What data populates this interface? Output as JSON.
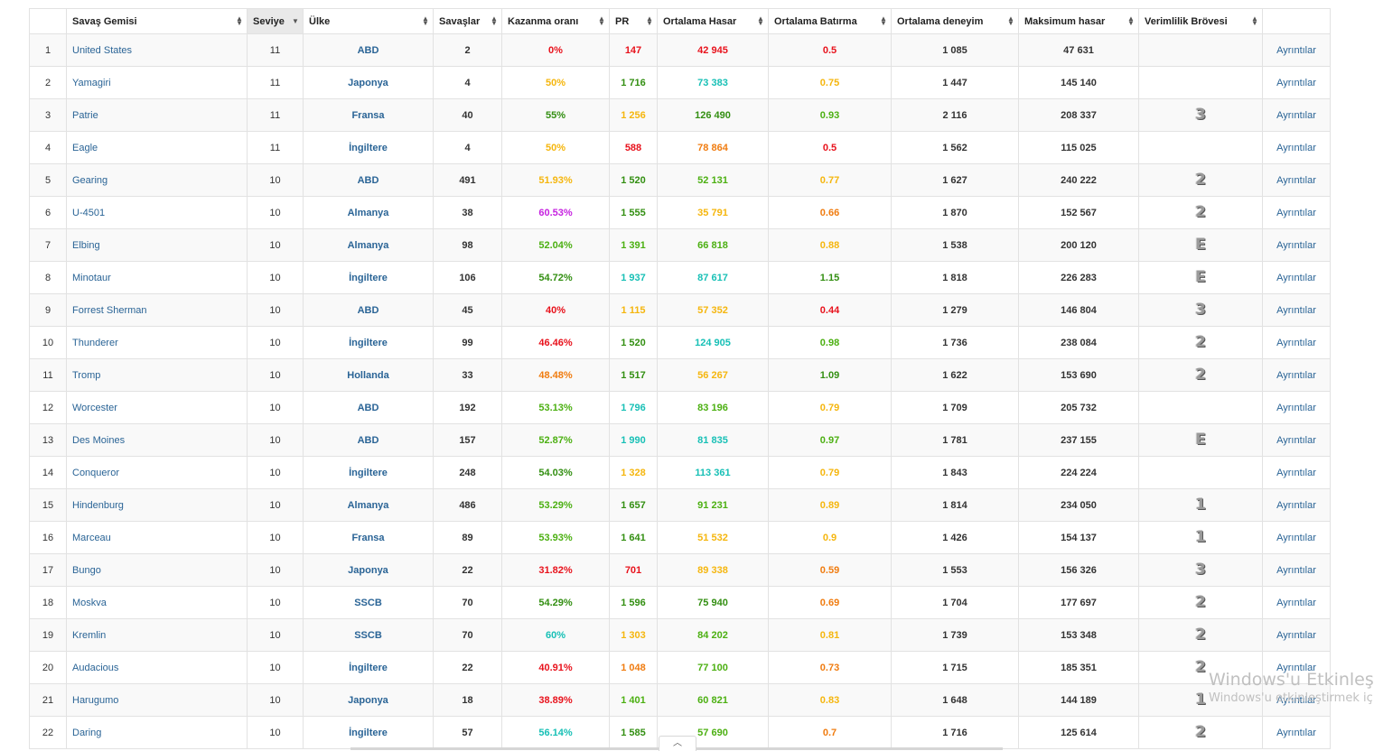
{
  "headers": [
    "",
    "Savaş Gemisi",
    "Seviye",
    "Ülke",
    "Savaşlar",
    "Kazanma oranı",
    "PR",
    "Ortalama Hasar",
    "Ortalama Batırma",
    "Ortalama deneyim",
    "Maksimum hasar",
    "Verimlilik Brövesi",
    ""
  ],
  "rows": [
    {
      "idx": "1",
      "name": "United States",
      "tier": "11",
      "nation": "ABD",
      "battles": "2",
      "wr": "0%",
      "wr_c": "red",
      "pr": "147",
      "pr_c": "red",
      "dmg": "42 945",
      "dmg_c": "red",
      "kills": "0.5",
      "kills_c": "red",
      "xp": "1 085",
      "maxdmg": "47 631",
      "badge": "",
      "details": "Ayrıntılar"
    },
    {
      "idx": "2",
      "name": "Yamagiri",
      "tier": "11",
      "nation": "Japonya",
      "battles": "4",
      "wr": "50%",
      "wr_c": "yellow",
      "pr": "1 716",
      "pr_c": "dgreen",
      "dmg": "73 383",
      "dmg_c": "teal",
      "kills": "0.75",
      "kills_c": "yellow",
      "xp": "1 447",
      "maxdmg": "145 140",
      "badge": "",
      "details": "Ayrıntılar"
    },
    {
      "idx": "3",
      "name": "Patrie",
      "tier": "11",
      "nation": "Fransa",
      "battles": "40",
      "wr": "55%",
      "wr_c": "dgreen",
      "pr": "1 256",
      "pr_c": "yellow",
      "dmg": "126 490",
      "dmg_c": "dgreen",
      "kills": "0.93",
      "kills_c": "lgreen",
      "xp": "2 116",
      "maxdmg": "208 337",
      "badge": "3",
      "details": "Ayrıntılar"
    },
    {
      "idx": "4",
      "name": "Eagle",
      "tier": "11",
      "nation": "İngiltere",
      "battles": "4",
      "wr": "50%",
      "wr_c": "yellow",
      "pr": "588",
      "pr_c": "red",
      "dmg": "78 864",
      "dmg_c": "orange",
      "kills": "0.5",
      "kills_c": "red",
      "xp": "1 562",
      "maxdmg": "115 025",
      "badge": "",
      "details": "Ayrıntılar"
    },
    {
      "idx": "5",
      "name": "Gearing",
      "tier": "10",
      "nation": "ABD",
      "battles": "491",
      "wr": "51.93%",
      "wr_c": "yellow",
      "pr": "1 520",
      "pr_c": "dgreen",
      "dmg": "52 131",
      "dmg_c": "lgreen",
      "kills": "0.77",
      "kills_c": "yellow",
      "xp": "1 627",
      "maxdmg": "240 222",
      "badge": "2",
      "details": "Ayrıntılar"
    },
    {
      "idx": "6",
      "name": "U-4501",
      "tier": "10",
      "nation": "Almanya",
      "battles": "38",
      "wr": "60.53%",
      "wr_c": "purple",
      "pr": "1 555",
      "pr_c": "dgreen",
      "dmg": "35 791",
      "dmg_c": "yellow",
      "kills": "0.66",
      "kills_c": "orange",
      "xp": "1 870",
      "maxdmg": "152 567",
      "badge": "2",
      "details": "Ayrıntılar"
    },
    {
      "idx": "7",
      "name": "Elbing",
      "tier": "10",
      "nation": "Almanya",
      "battles": "98",
      "wr": "52.04%",
      "wr_c": "lgreen",
      "pr": "1 391",
      "pr_c": "lgreen",
      "dmg": "66 818",
      "dmg_c": "lgreen",
      "kills": "0.88",
      "kills_c": "yellow",
      "xp": "1 538",
      "maxdmg": "200 120",
      "badge": "E",
      "details": "Ayrıntılar"
    },
    {
      "idx": "8",
      "name": "Minotaur",
      "tier": "10",
      "nation": "İngiltere",
      "battles": "106",
      "wr": "54.72%",
      "wr_c": "dgreen",
      "pr": "1 937",
      "pr_c": "teal",
      "dmg": "87 617",
      "dmg_c": "teal",
      "kills": "1.15",
      "kills_c": "dgreen",
      "xp": "1 818",
      "maxdmg": "226 283",
      "badge": "E",
      "details": "Ayrıntılar"
    },
    {
      "idx": "9",
      "name": "Forrest Sherman",
      "tier": "10",
      "nation": "ABD",
      "battles": "45",
      "wr": "40%",
      "wr_c": "red",
      "pr": "1 115",
      "pr_c": "yellow",
      "dmg": "57 352",
      "dmg_c": "yellow",
      "kills": "0.44",
      "kills_c": "red",
      "xp": "1 279",
      "maxdmg": "146 804",
      "badge": "3",
      "details": "Ayrıntılar"
    },
    {
      "idx": "10",
      "name": "Thunderer",
      "tier": "10",
      "nation": "İngiltere",
      "battles": "99",
      "wr": "46.46%",
      "wr_c": "red",
      "pr": "1 520",
      "pr_c": "dgreen",
      "dmg": "124 905",
      "dmg_c": "teal",
      "kills": "0.98",
      "kills_c": "lgreen",
      "xp": "1 736",
      "maxdmg": "238 084",
      "badge": "2",
      "details": "Ayrıntılar"
    },
    {
      "idx": "11",
      "name": "Tromp",
      "tier": "10",
      "nation": "Hollanda",
      "battles": "33",
      "wr": "48.48%",
      "wr_c": "orange",
      "pr": "1 517",
      "pr_c": "dgreen",
      "dmg": "56 267",
      "dmg_c": "yellow",
      "kills": "1.09",
      "kills_c": "dgreen",
      "xp": "1 622",
      "maxdmg": "153 690",
      "badge": "2",
      "details": "Ayrıntılar"
    },
    {
      "idx": "12",
      "name": "Worcester",
      "tier": "10",
      "nation": "ABD",
      "battles": "192",
      "wr": "53.13%",
      "wr_c": "lgreen",
      "pr": "1 796",
      "pr_c": "teal",
      "dmg": "83 196",
      "dmg_c": "lgreen",
      "kills": "0.79",
      "kills_c": "yellow",
      "xp": "1 709",
      "maxdmg": "205 732",
      "badge": "",
      "details": "Ayrıntılar"
    },
    {
      "idx": "13",
      "name": "Des Moines",
      "tier": "10",
      "nation": "ABD",
      "battles": "157",
      "wr": "52.87%",
      "wr_c": "lgreen",
      "pr": "1 990",
      "pr_c": "teal",
      "dmg": "81 835",
      "dmg_c": "teal",
      "kills": "0.97",
      "kills_c": "lgreen",
      "xp": "1 781",
      "maxdmg": "237 155",
      "badge": "E",
      "details": "Ayrıntılar"
    },
    {
      "idx": "14",
      "name": "Conqueror",
      "tier": "10",
      "nation": "İngiltere",
      "battles": "248",
      "wr": "54.03%",
      "wr_c": "dgreen",
      "pr": "1 328",
      "pr_c": "yellow",
      "dmg": "113 361",
      "dmg_c": "teal",
      "kills": "0.79",
      "kills_c": "yellow",
      "xp": "1 843",
      "maxdmg": "224 224",
      "badge": "",
      "details": "Ayrıntılar"
    },
    {
      "idx": "15",
      "name": "Hindenburg",
      "tier": "10",
      "nation": "Almanya",
      "battles": "486",
      "wr": "53.29%",
      "wr_c": "lgreen",
      "pr": "1 657",
      "pr_c": "dgreen",
      "dmg": "91 231",
      "dmg_c": "lgreen",
      "kills": "0.89",
      "kills_c": "yellow",
      "xp": "1 814",
      "maxdmg": "234 050",
      "badge": "1",
      "details": "Ayrıntılar"
    },
    {
      "idx": "16",
      "name": "Marceau",
      "tier": "10",
      "nation": "Fransa",
      "battles": "89",
      "wr": "53.93%",
      "wr_c": "lgreen",
      "pr": "1 641",
      "pr_c": "dgreen",
      "dmg": "51 532",
      "dmg_c": "yellow",
      "kills": "0.9",
      "kills_c": "yellow",
      "xp": "1 426",
      "maxdmg": "154 137",
      "badge": "1",
      "details": "Ayrıntılar"
    },
    {
      "idx": "17",
      "name": "Bungo",
      "tier": "10",
      "nation": "Japonya",
      "battles": "22",
      "wr": "31.82%",
      "wr_c": "red",
      "pr": "701",
      "pr_c": "red",
      "dmg": "89 338",
      "dmg_c": "yellow",
      "kills": "0.59",
      "kills_c": "orange",
      "xp": "1 553",
      "maxdmg": "156 326",
      "badge": "3",
      "details": "Ayrıntılar"
    },
    {
      "idx": "18",
      "name": "Moskva",
      "tier": "10",
      "nation": "SSCB",
      "battles": "70",
      "wr": "54.29%",
      "wr_c": "dgreen",
      "pr": "1 596",
      "pr_c": "dgreen",
      "dmg": "75 940",
      "dmg_c": "dgreen",
      "kills": "0.69",
      "kills_c": "orange",
      "xp": "1 704",
      "maxdmg": "177 697",
      "badge": "2",
      "details": "Ayrıntılar"
    },
    {
      "idx": "19",
      "name": "Kremlin",
      "tier": "10",
      "nation": "SSCB",
      "battles": "70",
      "wr": "60%",
      "wr_c": "teal",
      "pr": "1 303",
      "pr_c": "yellow",
      "dmg": "84 202",
      "dmg_c": "lgreen",
      "kills": "0.81",
      "kills_c": "yellow",
      "xp": "1 739",
      "maxdmg": "153 348",
      "badge": "2",
      "details": "Ayrıntılar"
    },
    {
      "idx": "20",
      "name": "Audacious",
      "tier": "10",
      "nation": "İngiltere",
      "battles": "22",
      "wr": "40.91%",
      "wr_c": "red",
      "pr": "1 048",
      "pr_c": "orange",
      "dmg": "77 100",
      "dmg_c": "lgreen",
      "kills": "0.73",
      "kills_c": "orange",
      "xp": "1 715",
      "maxdmg": "185 351",
      "badge": "2",
      "details": "Ayrıntılar"
    },
    {
      "idx": "21",
      "name": "Harugumo",
      "tier": "10",
      "nation": "Japonya",
      "battles": "18",
      "wr": "38.89%",
      "wr_c": "red",
      "pr": "1 401",
      "pr_c": "lgreen",
      "dmg": "60 821",
      "dmg_c": "lgreen",
      "kills": "0.83",
      "kills_c": "yellow",
      "xp": "1 648",
      "maxdmg": "144 189",
      "badge": "1",
      "details": "Ayrıntılar"
    },
    {
      "idx": "22",
      "name": "Daring",
      "tier": "10",
      "nation": "İngiltere",
      "battles": "57",
      "wr": "56.14%",
      "wr_c": "teal",
      "pr": "1 585",
      "pr_c": "dgreen",
      "dmg": "57 690",
      "dmg_c": "lgreen",
      "kills": "0.7",
      "kills_c": "orange",
      "xp": "1 716",
      "maxdmg": "125 614",
      "badge": "2",
      "details": "Ayrıntılar"
    }
  ],
  "watermark": {
    "line1": "Windows'u Etkinleştir",
    "line2": "Windows'u etkinleştirmek iç"
  },
  "scroll_top_icon": "chevron-up-icon",
  "colors": {
    "red": "#e8121c",
    "orange": "#f07c10",
    "yellow": "#f5b60e",
    "lgreen": "#4cb012",
    "dgreen": "#338f12",
    "teal": "#18c0b6",
    "purple": "#c623e0",
    "link": "#2a6496"
  }
}
